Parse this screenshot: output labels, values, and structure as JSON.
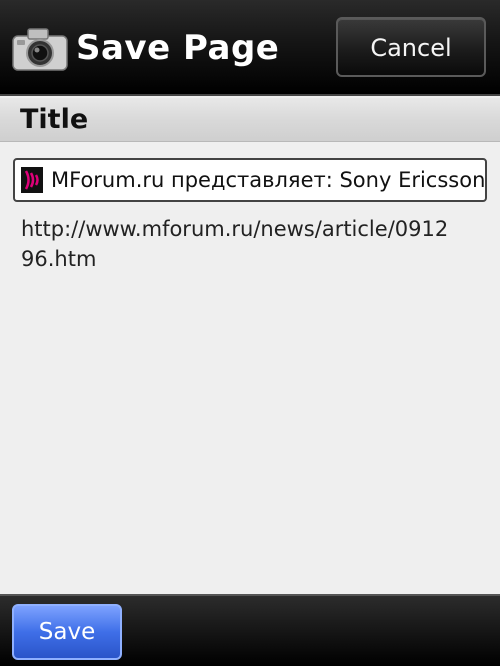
{
  "header": {
    "title": "Save Page",
    "cancel_label": "Cancel",
    "icon": "camera-icon"
  },
  "section": {
    "title": "Title"
  },
  "page": {
    "title_value": "MForum.ru представляет: Sony Ericsson",
    "favicon": "mforum-favicon-icon",
    "url": "http://www.mforum.ru/news/article/091296.htm"
  },
  "footer": {
    "save_label": "Save"
  },
  "colors": {
    "header_bg": "#151515",
    "save_button": "#3f6fe8",
    "favicon_accent": "#e0007a"
  }
}
